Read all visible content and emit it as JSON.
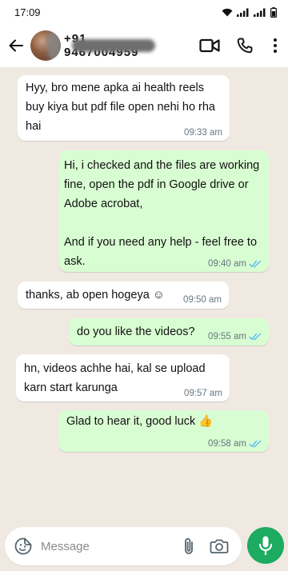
{
  "status_bar": {
    "time": "17:09"
  },
  "header": {
    "contact_name": "+91 9467004959",
    "icons": [
      "back-arrow-icon",
      "video-call-icon",
      "phone-icon",
      "more-vertical-icon"
    ]
  },
  "messages": [
    {
      "direction": "in",
      "text": "Hyy, bro mene apka ai health reels buy kiya but pdf file open nehi ho rha hai",
      "time": "09:33 am"
    },
    {
      "direction": "out",
      "text": "Hi, i checked and the files are working fine, open the pdf in Google drive or Adobe acrobat,\n\nAnd if you need any help - feel free to ask.",
      "time": "09:40 am",
      "status": "read"
    },
    {
      "direction": "in",
      "text": "thanks, ab open hogeya ☺",
      "time": "09:50 am"
    },
    {
      "direction": "out",
      "text": "do you like the videos?",
      "time": "09:55 am",
      "status": "read"
    },
    {
      "direction": "in",
      "text": "hn, videos achhe hai, kal se upload karn start karunga",
      "time": "09:57 am"
    },
    {
      "direction": "out",
      "text": "Glad to hear it, good luck 👍",
      "time": "09:58 am",
      "status": "read"
    }
  ],
  "composer": {
    "placeholder": "Message",
    "icons": [
      "emoji-sticker-icon",
      "attach-icon",
      "camera-icon",
      "mic-icon"
    ]
  },
  "colors": {
    "background": "#efe9e2",
    "incoming_bubble": "#ffffff",
    "outgoing_bubble": "#d9fdd3",
    "read_ticks": "#53bdeb",
    "mic_button": "#1daa61"
  }
}
